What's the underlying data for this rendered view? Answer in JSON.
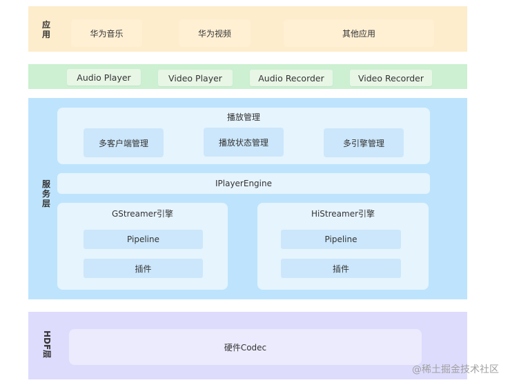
{
  "application_layer": {
    "label_chars": [
      "应",
      "用"
    ],
    "items": [
      "华为音乐",
      "华为视频",
      "其他应用"
    ],
    "color": "#fdedcc"
  },
  "player_layer": {
    "items": [
      "Audio Player",
      "Video Player",
      "Audio Recorder",
      "Video Recorder"
    ],
    "color": "#ccf0d1"
  },
  "service_layer": {
    "label_chars": [
      "服",
      "务",
      "层"
    ],
    "color": "#bee4fd",
    "playback_management": {
      "title": "播放管理",
      "items": [
        "多客户端管理",
        "播放状态管理",
        "多引擎管理"
      ]
    },
    "engine_interface": "IPlayerEngine",
    "engines": [
      {
        "title": "GStreamer引擎",
        "items": [
          "Pipeline",
          "插件"
        ]
      },
      {
        "title": "HiStreamer引擎",
        "items": [
          "Pipeline",
          "插件"
        ]
      }
    ]
  },
  "hdf_layer": {
    "label": "HDF层",
    "item": "硬件Codec",
    "color": "#dddcfd"
  },
  "watermark": "@稀土掘金技术社区"
}
